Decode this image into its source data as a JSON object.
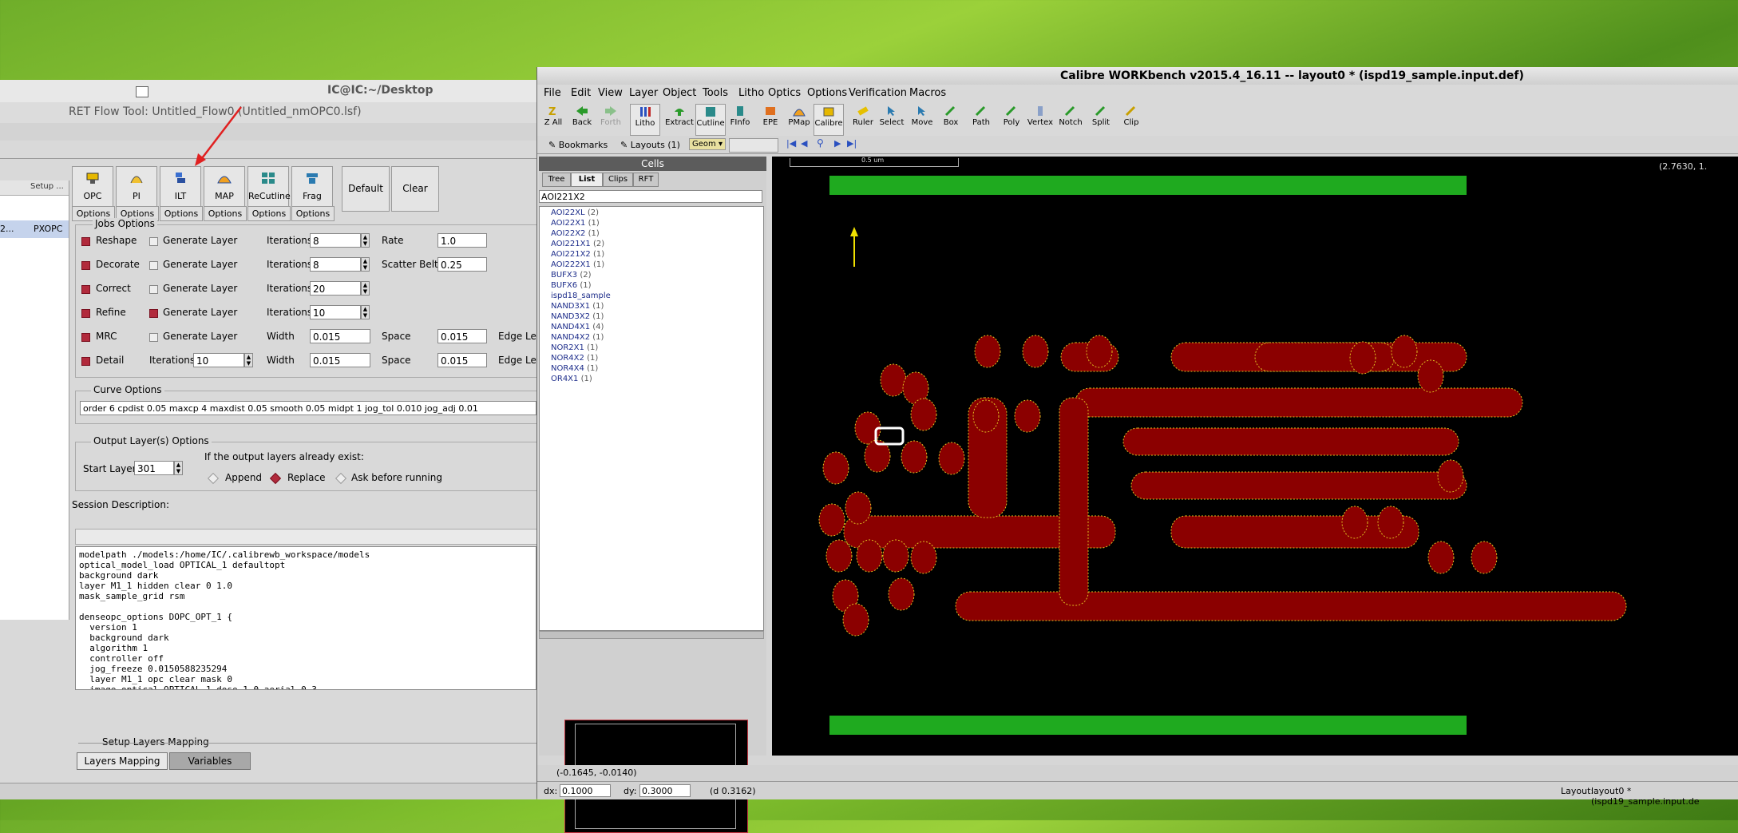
{
  "ret": {
    "window_title": "IC@IC:~/Desktop",
    "subtitle": "RET Flow Tool: Untitled_Flow0 (Untitled_nmOPC0.lsf)",
    "left_header": "Setup ...",
    "left_row_name": "2...",
    "left_row_value": "PXOPC",
    "tools": [
      {
        "label": "OPC",
        "opt": "Options"
      },
      {
        "label": "PI",
        "opt": "Options"
      },
      {
        "label": "ILT",
        "opt": "Options"
      },
      {
        "label": "MAP",
        "opt": "Options"
      },
      {
        "label": "ReCutline",
        "opt": "Options"
      },
      {
        "label": "Frag",
        "opt": "Options"
      }
    ],
    "default_label": "Default",
    "clear_label": "Clear",
    "jobs_title": "Jobs Options",
    "jobs": [
      {
        "name": "Reshape",
        "gen": "Generate Layer",
        "p1": "Iterations",
        "v1": "8",
        "p2": "Rate",
        "v2": "1.0"
      },
      {
        "name": "Decorate",
        "gen": "Generate Layer",
        "p1": "Iterations",
        "v1": "8",
        "p2": "Scatter Belt",
        "v2": "0.25"
      },
      {
        "name": "Correct",
        "gen": "Generate Layer",
        "p1": "Iterations",
        "v1": "20"
      },
      {
        "name": "Refine",
        "gen": "Generate Layer",
        "p1": "Iterations",
        "v1": "10"
      },
      {
        "name": "MRC",
        "gen": "Generate Layer",
        "p1": "Width",
        "v1": "0.015",
        "p2": "Space",
        "v2": "0.015",
        "p3": "Edge Le"
      },
      {
        "name": "Detail",
        "iter_label": "Iterations",
        "iter_val": "10",
        "p1": "Width",
        "v1": "0.015",
        "p2": "Space",
        "v2": "0.015",
        "p3": "Edge Le"
      }
    ],
    "curve_title": "Curve Options",
    "curve_value": "order 6 cpdist 0.05 maxcp 4 maxdist 0.05 smooth 0.05 midpt 1 jog_tol 0.010 jog_adj 0.01",
    "output_title": "Output Layer(s) Options",
    "start_layer_label": "Start Layer",
    "start_layer_value": "301",
    "exist_label": "If the output layers already exist:",
    "append": "Append",
    "replace": "Replace",
    "ask": "Ask before running",
    "session_label": "Session Description:",
    "script": "modelpath ./models:/home/IC/.calibrewb_workspace/models\noptical_model_load OPTICAL_1 defaultopt\nbackground dark\nlayer M1_1 hidden clear 0 1.0\nmask_sample_grid rsm\n\ndenseopc_options DOPC_OPT_1 {\n  version 1\n  background dark\n  algorithm 1\n  controller off\n  jog_freeze 0.0150588235294\n  layer M1_1 opc clear mask 0\n  image optical OPTICAL_1 dose 1.0 aerial 0.3",
    "setup_layers": "Setup Layers Mapping",
    "tab_layers": "Layers Mapping",
    "tab_vars": "Variables"
  },
  "calibre": {
    "title": "Calibre WORKbench v2015.4_16.11  --  layout0 * (ispd19_sample.input.def)",
    "menus": [
      "File",
      "Edit",
      "View",
      "Layer",
      "Object",
      "Tools",
      "Litho",
      "Optics",
      "Options",
      "Verification",
      "Macros"
    ],
    "tools": [
      "Z All",
      "Back",
      "Forth",
      "Litho",
      "Extract",
      "Cutline",
      "FInfo",
      "EPE",
      "PMap",
      "Calibre",
      "Ruler",
      "Select",
      "Move",
      "Box",
      "Path",
      "Poly",
      "Vertex",
      "Notch",
      "Split",
      "Clip"
    ],
    "bookmarks": "Bookmarks",
    "layouts": "Layouts (1)",
    "geom": "Geom",
    "scale_label": "0.5 um",
    "cells_header": "Cells",
    "cell_tabs": [
      "Tree",
      "List",
      "Clips",
      "RFT"
    ],
    "cell_filter": "AOI221X2",
    "cells": [
      {
        "name": "AOI22XL",
        "count": "(2)"
      },
      {
        "name": "AOI22X1",
        "count": "(1)"
      },
      {
        "name": "AOI22X2",
        "count": "(1)"
      },
      {
        "name": "AOI221X1",
        "count": "(2)"
      },
      {
        "name": "AOI221X2",
        "count": "(1)"
      },
      {
        "name": "AOI222X1",
        "count": "(1)"
      },
      {
        "name": "BUFX3",
        "count": "(2)"
      },
      {
        "name": "BUFX6",
        "count": "(1)"
      },
      {
        "name": "ispd18_sample",
        "count": ""
      },
      {
        "name": "NAND3X1",
        "count": "(1)"
      },
      {
        "name": "NAND3X2",
        "count": "(1)"
      },
      {
        "name": "NAND4X1",
        "count": "(4)"
      },
      {
        "name": "NAND4X2",
        "count": "(1)"
      },
      {
        "name": "NOR2X1",
        "count": "(1)"
      },
      {
        "name": "NOR4X2",
        "count": "(1)"
      },
      {
        "name": "NOR4X4",
        "count": "(1)"
      },
      {
        "name": "OR4X1",
        "count": "(1)"
      }
    ],
    "coord_top": "(2.7630, 1.",
    "coord_bottom": "(-0.1645, -0.0140)",
    "dx_label": "dx:",
    "dx_value": "0.1000",
    "dy_label": "dy:",
    "dy_value": "0.3000",
    "d_value": "(d 0.3162)",
    "layout_label": "Layout:",
    "layout_value": "layout0 * (ispd19_sample.input.de"
  },
  "colors": {
    "accent": "#b12a3c",
    "shape_fill": "#8b0000",
    "shape_edge": "#e0c020",
    "bar_green": "#1faa1f"
  }
}
